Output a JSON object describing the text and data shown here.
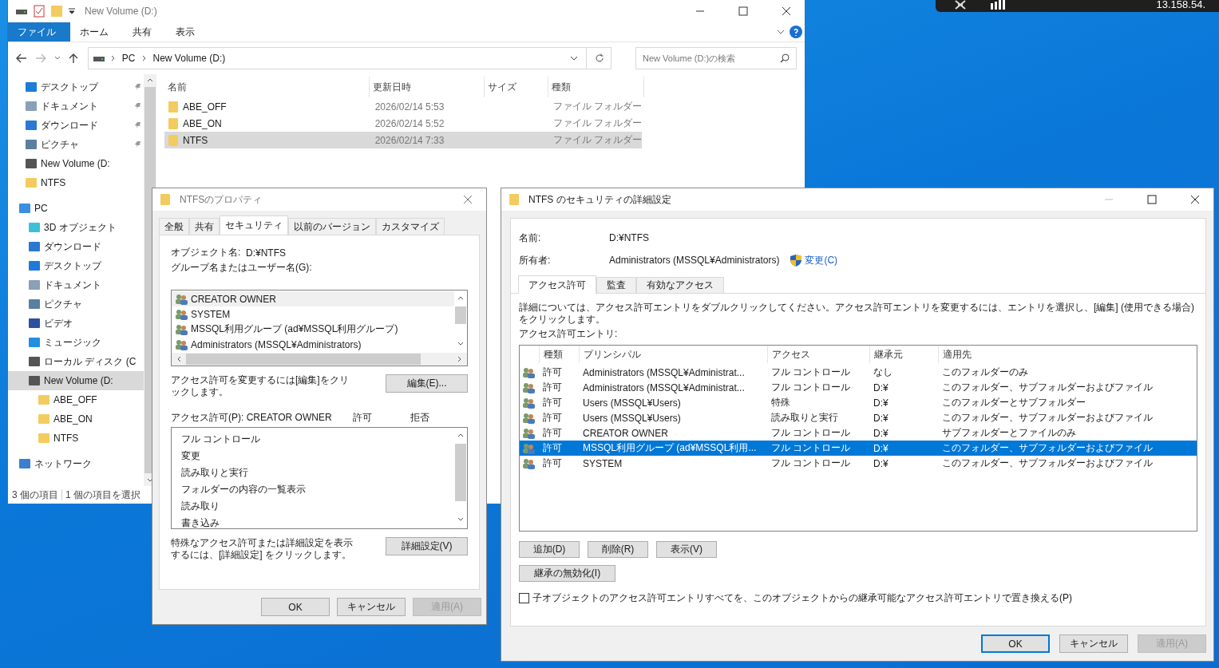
{
  "overlay": {
    "text": "13.158.54."
  },
  "explorer": {
    "title": "New Volume (D:)",
    "ribbon_tabs": [
      {
        "label": "ファイル",
        "selected": true
      },
      {
        "label": "ホーム",
        "selected": false
      },
      {
        "label": "共有",
        "selected": false
      },
      {
        "label": "表示",
        "selected": false
      }
    ],
    "address": [
      "PC",
      "New Volume (D:)"
    ],
    "search": {
      "placeholder": "New Volume (D:)の検索"
    },
    "quick_access": [
      {
        "label": "デスクトップ",
        "kind": "desktop",
        "pinned": true,
        "selected": false
      },
      {
        "label": "ドキュメント",
        "kind": "document",
        "pinned": true,
        "selected": false
      },
      {
        "label": "ダウンロード",
        "kind": "download",
        "pinned": true,
        "selected": false
      },
      {
        "label": "ピクチャ",
        "kind": "picture-folder",
        "pinned": true,
        "selected": false
      },
      {
        "label": "New Volume (D:",
        "kind": "drive",
        "pinned": false,
        "selected": false
      },
      {
        "label": "NTFS",
        "kind": "folder",
        "pinned": false,
        "selected": false
      }
    ],
    "tree": [
      {
        "label": "PC",
        "kind": "pc",
        "selected": false,
        "children": [
          {
            "label": "3D オブジェクト",
            "kind": "cube",
            "selected": false
          },
          {
            "label": "ダウンロード",
            "kind": "download",
            "selected": false
          },
          {
            "label": "デスクトップ",
            "kind": "desktop",
            "selected": false
          },
          {
            "label": "ドキュメント",
            "kind": "document",
            "selected": false
          },
          {
            "label": "ピクチャ",
            "kind": "picture-folder",
            "selected": false
          },
          {
            "label": "ビデオ",
            "kind": "video",
            "selected": false
          },
          {
            "label": "ミュージック",
            "kind": "music",
            "selected": false
          },
          {
            "label": "ローカル ディスク (C",
            "kind": "drive",
            "selected": false
          },
          {
            "label": "New Volume (D:",
            "kind": "drive",
            "selected": true,
            "children": [
              {
                "label": "ABE_OFF",
                "kind": "folder",
                "selected": false
              },
              {
                "label": "ABE_ON",
                "kind": "folder",
                "selected": false
              },
              {
                "label": "NTFS",
                "kind": "folder",
                "selected": false
              }
            ]
          }
        ]
      },
      {
        "label": "ネットワーク",
        "kind": "network",
        "selected": false
      }
    ],
    "columns": [
      "名前",
      "更新日時",
      "サイズ",
      "種類"
    ],
    "rows": [
      {
        "name": "ABE_OFF",
        "modified": "2026/02/14 5:53",
        "type": "ファイル フォルダー",
        "selected": false
      },
      {
        "name": "ABE_ON",
        "modified": "2026/02/14 5:52",
        "type": "ファイル フォルダー",
        "selected": false
      },
      {
        "name": "NTFS",
        "modified": "2026/02/14 7:33",
        "type": "ファイル フォルダー",
        "selected": true
      }
    ],
    "status": [
      "3 個の項目",
      "1 個の項目を選択"
    ]
  },
  "properties": {
    "title": "NTFSのプロパティ",
    "tabs": [
      {
        "label": "全般",
        "selected": false
      },
      {
        "label": "共有",
        "selected": false
      },
      {
        "label": "セキュリティ",
        "selected": true
      },
      {
        "label": "以前のバージョン",
        "selected": false
      },
      {
        "label": "カスタマイズ",
        "selected": false
      }
    ],
    "object_label": "オブジェクト名:",
    "object_value": "D:¥NTFS",
    "group_label": "グループ名またはユーザー名(G):",
    "principals": [
      {
        "name": "CREATOR OWNER",
        "selected": true
      },
      {
        "name": "SYSTEM",
        "selected": false
      },
      {
        "name": "MSSQL利用グループ (ad¥MSSQL利用グループ)",
        "selected": false
      },
      {
        "name": "Administrators (MSSQL¥Administrators)",
        "selected": false
      }
    ],
    "edit_note": "アクセス許可を変更するには[編集]をクリックします。",
    "edit_button": "編集(E)...",
    "permissions_label": "アクセス許可(P): CREATOR OWNER",
    "allow_header": "許可",
    "deny_header": "拒否",
    "permissions": [
      "フル コントロール",
      "変更",
      "読み取りと実行",
      "フォルダーの内容の一覧表示",
      "読み取り",
      "書き込み"
    ],
    "advanced_note": "特殊なアクセス許可または詳細設定を表示するには、[詳細設定] をクリックします。",
    "advanced_button": "詳細設定(V)",
    "buttons": [
      {
        "label": "OK",
        "disabled": false
      },
      {
        "label": "キャンセル",
        "disabled": false
      },
      {
        "label": "適用(A)",
        "disabled": true
      }
    ]
  },
  "advanced": {
    "title": "NTFS のセキュリティの詳細設定",
    "name_label": "名前:",
    "name_value": "D:¥NTFS",
    "owner_label": "所有者:",
    "owner_value": "Administrators (MSSQL¥Administrators)",
    "change_link": "変更(C)",
    "tabs": [
      {
        "label": "アクセス許可",
        "selected": true
      },
      {
        "label": "監査",
        "selected": false
      },
      {
        "label": "有効なアクセス",
        "selected": false
      }
    ],
    "info": "詳細については、アクセス許可エントリをダブルクリックしてください。アクセス許可エントリを変更するには、エントリを選択し、[編集] (使用できる場合) をクリックします。",
    "entries_label": "アクセス許可エントリ:",
    "columns": [
      "種類",
      "プリンシパル",
      "アクセス",
      "継承元",
      "適用先"
    ],
    "rows": [
      {
        "type": "許可",
        "principal": "Administrators (MSSQL¥Administrat...",
        "access": "フル コントロール",
        "inherited_from": "なし",
        "applies_to": "このフォルダーのみ",
        "selected": false
      },
      {
        "type": "許可",
        "principal": "Administrators (MSSQL¥Administrat...",
        "access": "フル コントロール",
        "inherited_from": "D:¥",
        "applies_to": "このフォルダー、サブフォルダーおよびファイル",
        "selected": false
      },
      {
        "type": "許可",
        "principal": "Users (MSSQL¥Users)",
        "access": "特殊",
        "inherited_from": "D:¥",
        "applies_to": "このフォルダーとサブフォルダー",
        "selected": false
      },
      {
        "type": "許可",
        "principal": "Users (MSSQL¥Users)",
        "access": "読み取りと実行",
        "inherited_from": "D:¥",
        "applies_to": "このフォルダー、サブフォルダーおよびファイル",
        "selected": false
      },
      {
        "type": "許可",
        "principal": "CREATOR OWNER",
        "access": "フル コントロール",
        "inherited_from": "D:¥",
        "applies_to": "サブフォルダーとファイルのみ",
        "selected": false
      },
      {
        "type": "許可",
        "principal": "MSSQL利用グループ (ad¥MSSQL利用...",
        "access": "フル コントロール",
        "inherited_from": "D:¥",
        "applies_to": "このフォルダー、サブフォルダーおよびファイル",
        "selected": true
      },
      {
        "type": "許可",
        "principal": "SYSTEM",
        "access": "フル コントロール",
        "inherited_from": "D:¥",
        "applies_to": "このフォルダー、サブフォルダーおよびファイル",
        "selected": false
      }
    ],
    "entry_buttons": [
      "追加(D)",
      "削除(R)",
      "表示(V)"
    ],
    "disable_inheritance": "継承の無効化(I)",
    "replace_option": {
      "label": "子オブジェクトのアクセス許可エントリすべてを、このオブジェクトからの継承可能なアクセス許可エントリで置き換える(P)",
      "checked": false
    },
    "buttons": [
      {
        "label": "OK",
        "disabled": false
      },
      {
        "label": "キャンセル",
        "disabled": false
      },
      {
        "label": "適用(A)",
        "disabled": true
      }
    ]
  }
}
